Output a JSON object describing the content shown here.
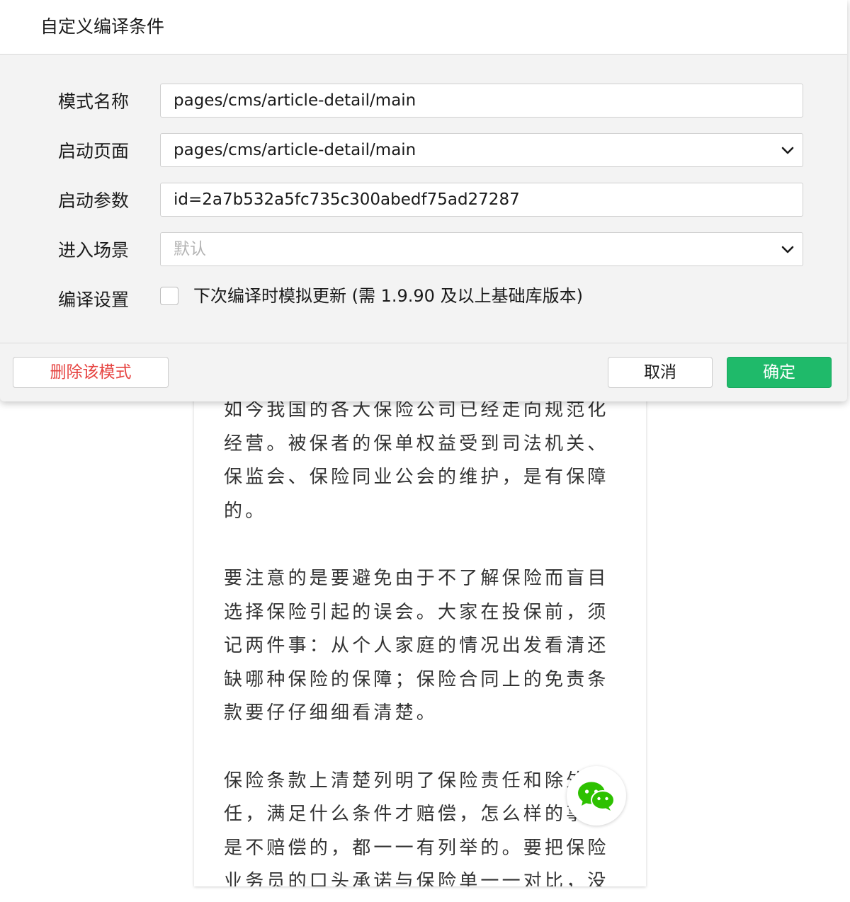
{
  "dialog": {
    "title": "自定义编译条件",
    "fields": {
      "mode_name": {
        "label": "模式名称",
        "value": "pages/cms/article-detail/main"
      },
      "start_page": {
        "label": "启动页面",
        "value": "pages/cms/article-detail/main",
        "icon": "chevron-down-icon"
      },
      "start_params": {
        "label": "启动参数",
        "value": "id=2a7b532a5fc735c300abedf75ad27287"
      },
      "scene": {
        "label": "进入场景",
        "placeholder": "默认",
        "icon": "chevron-down-icon"
      },
      "compile_settings": {
        "label": "编译设置",
        "checkbox_label": "下次编译时模拟更新 (需 1.9.90 及以上基础库版本)",
        "checked": false
      }
    },
    "buttons": {
      "delete": "删除该模式",
      "cancel": "取消",
      "confirm": "确定"
    }
  },
  "article": {
    "paragraphs": [
      "如今我国的各大保险公司已经走向规范化经营。被保者的保单权益受到司法机关、保监会、保险同业公会的维护，是有保障的。",
      "要注意的是要避免由于不了解保险而盲目选择保险引起的误会。大家在投保前，须记两件事：从个人家庭的情况出发看清还缺哪种保险的保障；保险合同上的免责条款要仔仔细细看清楚。",
      "保险条款上清楚列明了保险责任和除外责任，满足什么条件才赔偿，怎么样的事故是不赔偿的，都一一有列举的。要把保险业务员的口头承诺与保险单一一对比，没"
    ]
  },
  "share_button": {
    "icon": "wechat-icon"
  },
  "colors": {
    "confirm_green": "#1fba6a",
    "delete_red": "#e64340",
    "dialog_bg": "#f3f3f3"
  }
}
